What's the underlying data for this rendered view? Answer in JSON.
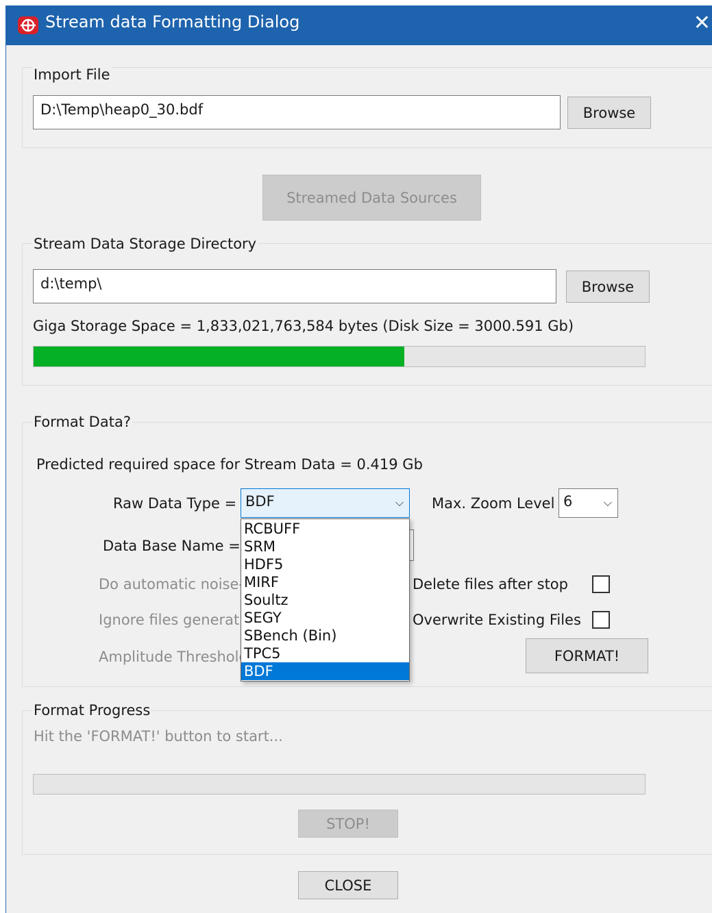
{
  "window": {
    "title": "Stream data Formatting Dialog",
    "close_glyph": "✕"
  },
  "import_file": {
    "group_label": "Import File",
    "path": "D:\\Temp\\heap0_30.bdf",
    "browse_label": "Browse"
  },
  "streamed_sources_label": "Streamed Data Sources",
  "storage": {
    "group_label": "Stream Data Storage Directory",
    "path": "d:\\temp\\",
    "browse_label": "Browse",
    "space_text": "Giga Storage Space = 1,833,021,763,584 bytes (Disk Size = 3000.591 Gb)",
    "usage_fraction": 0.607,
    "bar_color": "#06b025"
  },
  "format": {
    "group_label": "Format Data?",
    "predicted_text": "Predicted required space for Stream Data =  0.419 Gb",
    "raw_type_label": "Raw Data Type =",
    "raw_type_value": "BDF",
    "raw_type_options": [
      "RCBUFF",
      "SRM",
      "HDF5",
      "MIRF",
      "Soultz",
      "SEGY",
      "SBench (Bin)",
      "TPC5",
      "BDF"
    ],
    "max_zoom_label": "Max. Zoom Level",
    "max_zoom_value": "6",
    "db_name_label": "Data Base Name =",
    "noise_label": "Do automatic noise-sp",
    "ignore_label": "Ignore files generatin",
    "amplitude_label": "Amplitude Threshold:",
    "delete_label": "Delete files after stop",
    "delete_checked": false,
    "overwrite_label": "Overwrite Existing Files",
    "overwrite_checked": false,
    "format_button": "FORMAT!"
  },
  "progress": {
    "group_label": "Format Progress",
    "status_text": "Hit the 'FORMAT!' button to start...",
    "fraction": 0,
    "stop_button": "STOP!"
  },
  "close_button": "CLOSE",
  "colors": {
    "titlebar": "#1e63ad",
    "selection": "#0078d7"
  }
}
